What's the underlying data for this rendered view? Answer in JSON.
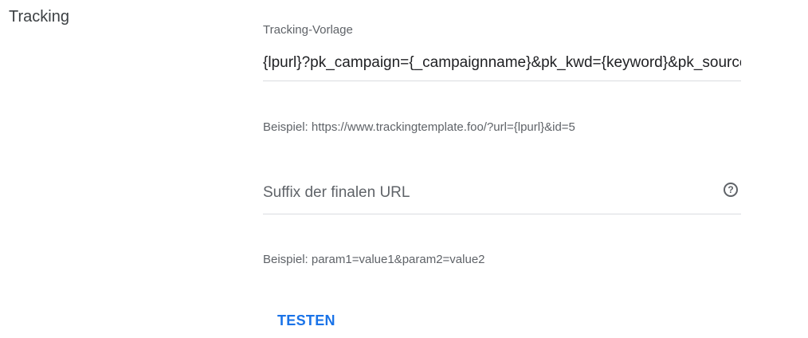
{
  "section": {
    "title": "Tracking"
  },
  "tracking_template": {
    "label": "Tracking-Vorlage",
    "value": "{lpurl}?pk_campaign={_campaignname}&pk_kwd={keyword}&pk_source=google",
    "helper": "Beispiel: https://www.trackingtemplate.foo/?url={lpurl}&id=5"
  },
  "final_url_suffix": {
    "placeholder": "Suffix der finalen URL",
    "value": "",
    "help_icon": "help-circle-icon",
    "help_glyph": "?",
    "helper": "Beispiel: param1=value1&param2=value2"
  },
  "actions": {
    "test_label": "TESTEN"
  },
  "colors": {
    "accent": "#1a73e8",
    "secondary_text": "#5f6368",
    "divider": "#dadce0"
  }
}
